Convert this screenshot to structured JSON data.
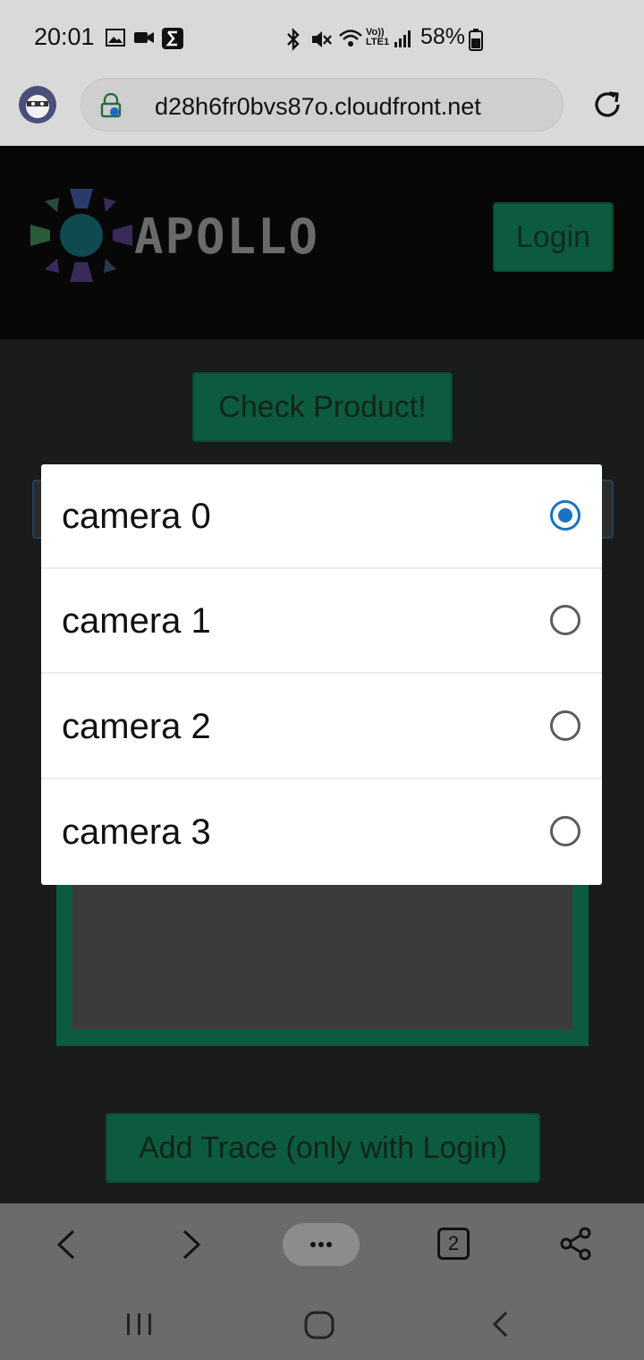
{
  "status_bar": {
    "time": "20:01",
    "battery": "58%",
    "icons": [
      "image-icon",
      "video-icon",
      "sigma-icon",
      "bluetooth-icon",
      "mute-icon",
      "wifi-icon",
      "volte-icon",
      "signal-icon",
      "battery-icon"
    ],
    "volte_label": "Vo)) LTE1"
  },
  "browser": {
    "url": "d28h6fr0bvs87o.cloudfront.net",
    "tab_count": "2"
  },
  "page": {
    "brand": "APOLLO",
    "login_label": "Login",
    "check_label": "Check Product!",
    "add_trace_label": "Add Trace (only with Login)"
  },
  "camera_picker": {
    "options": [
      {
        "label": "camera 0",
        "selected": true
      },
      {
        "label": "camera 1",
        "selected": false
      },
      {
        "label": "camera 2",
        "selected": false
      },
      {
        "label": "camera 3",
        "selected": false
      }
    ]
  },
  "colors": {
    "accent_green": "#0d5b3e",
    "radio_selected": "#1a72c0"
  }
}
